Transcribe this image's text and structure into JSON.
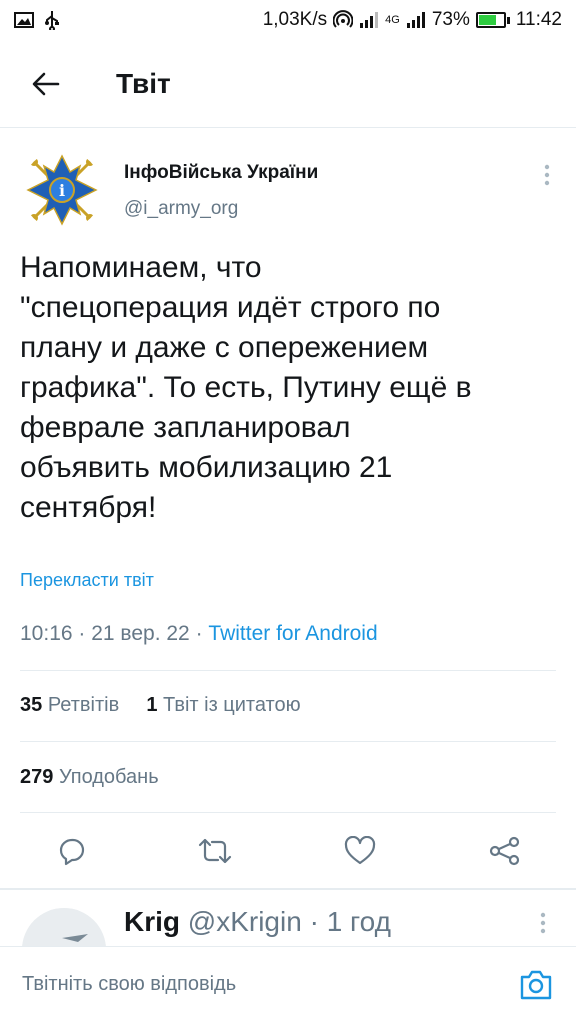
{
  "status_bar": {
    "speed": "1,03K/s",
    "network": "4G",
    "battery": "73%",
    "battery_level": 0.73,
    "time": "11:42"
  },
  "header": {
    "title": "Твіт"
  },
  "tweet": {
    "author_name": "ІнфоВійська України",
    "author_handle": "@i_army_org",
    "text": "Напоминаем, что\n\"спецоперация идёт строго по\nплану и даже с опережением\nграфика\". То есть, Путину ещё в\nфеврале запланировал\nобъявить мобилизацию 21\nсентября!",
    "translate_label": "Перекласти твіт",
    "time": "10:16",
    "date": "21 вер. 22",
    "source": "Twitter for Android",
    "retweets_count": "35",
    "retweets_label": "Ретвітів",
    "quotes_count": "1",
    "quotes_label": "Твіт із цитатою",
    "likes_count": "279",
    "likes_label": "Уподобань"
  },
  "reply_preview": {
    "name": "Krig",
    "handle": "@xKrigin",
    "time": "1 год"
  },
  "compose": {
    "placeholder": "Твітніть свою відповідь"
  },
  "colors": {
    "accent": "#1b95e0",
    "text": "#14171a",
    "muted": "#657786",
    "divider": "#e6ecf0"
  },
  "icons": [
    "back-arrow-icon",
    "more-vertical-icon",
    "reply-icon",
    "retweet-icon",
    "like-icon",
    "share-icon",
    "camera-icon"
  ]
}
